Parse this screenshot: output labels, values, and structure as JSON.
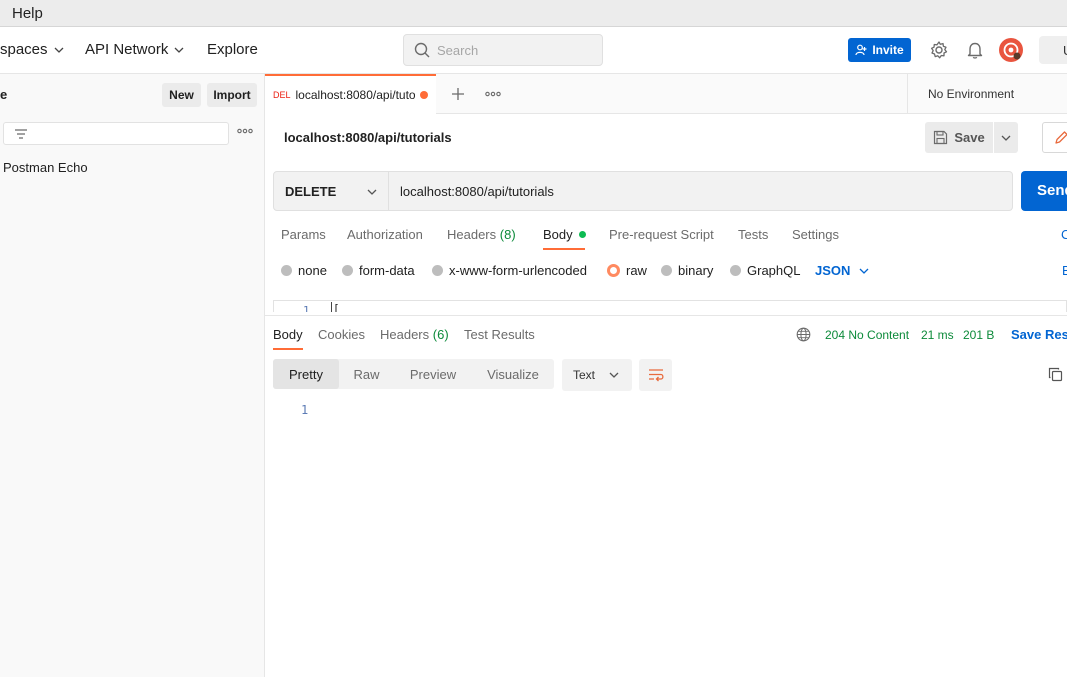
{
  "menubar": {
    "help": "Help"
  },
  "header": {
    "workspaces": "spaces",
    "api_network": "API Network",
    "explore": "Explore",
    "search_placeholder": "Search",
    "invite": "Invite",
    "upgrade_partial": "U"
  },
  "sidebar": {
    "title_partial": "e",
    "new_button": "New",
    "import_button": "Import",
    "collections": [
      {
        "label": "Postman Echo"
      }
    ]
  },
  "tabs": {
    "active": {
      "method": "DEL",
      "title": "localhost:8080/api/tutorials"
    },
    "environment": "No Environment"
  },
  "request": {
    "title": "localhost:8080/api/tutorials",
    "save": "Save",
    "method": "DELETE",
    "url": "localhost:8080/api/tutorials",
    "send": "Send",
    "tabs": {
      "params": "Params",
      "authorization": "Authorization",
      "headers": "Headers",
      "headers_count": "(8)",
      "body": "Body",
      "pre_request": "Pre-request Script",
      "tests": "Tests",
      "settings": "Settings",
      "cookies_partial": "C"
    },
    "body_types": {
      "none": "none",
      "form_data": "form-data",
      "urlencoded": "x-www-form-urlencoded",
      "raw": "raw",
      "binary": "binary",
      "graphql": "GraphQL",
      "selected": "raw"
    },
    "raw_format": "JSON",
    "beautify_partial": "B",
    "editor": {
      "line_no": "1",
      "code": "["
    }
  },
  "response": {
    "tabs": {
      "body": "Body",
      "cookies": "Cookies",
      "headers": "Headers",
      "headers_count": "(6)",
      "test_results": "Test Results"
    },
    "status": "204 No Content",
    "time": "21 ms",
    "size": "201 B",
    "save_response": "Save Resp",
    "views": {
      "pretty": "Pretty",
      "raw": "Raw",
      "preview": "Preview",
      "visualize": "Visualize"
    },
    "format": "Text",
    "line_no": "1"
  },
  "colors": {
    "brand_orange": "#ff6c37",
    "primary_blue": "#0265d2",
    "success_green": "#0c8a3a",
    "delete_red": "#eb2013"
  }
}
